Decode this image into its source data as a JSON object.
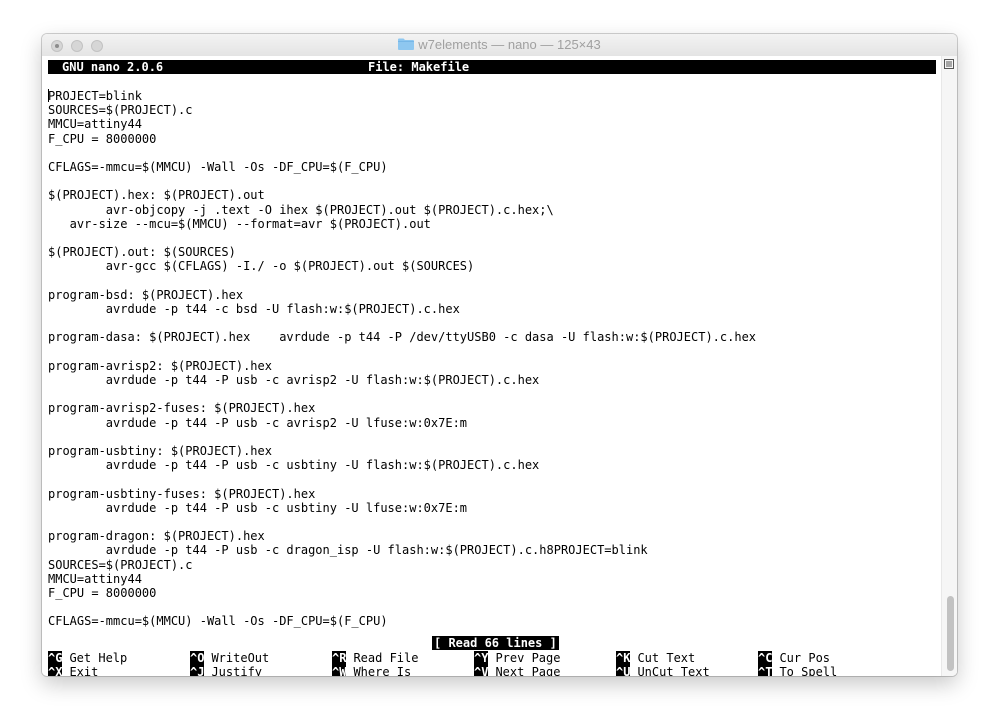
{
  "window": {
    "title": "w7elements — nano — 125×43"
  },
  "nano": {
    "version": "GNU nano 2.0.6",
    "file": "File: Makefile",
    "lines": [
      "PROJECT=blink",
      "SOURCES=$(PROJECT).c",
      "MMCU=attiny44",
      "F_CPU = 8000000",
      "",
      "CFLAGS=-mmcu=$(MMCU) -Wall -Os -DF_CPU=$(F_CPU)",
      "",
      "$(PROJECT).hex: $(PROJECT).out",
      "        avr-objcopy -j .text -O ihex $(PROJECT).out $(PROJECT).c.hex;\\",
      "   avr-size --mcu=$(MMCU) --format=avr $(PROJECT).out",
      "",
      "$(PROJECT).out: $(SOURCES)",
      "        avr-gcc $(CFLAGS) -I./ -o $(PROJECT).out $(SOURCES)",
      "",
      "program-bsd: $(PROJECT).hex",
      "        avrdude -p t44 -c bsd -U flash:w:$(PROJECT).c.hex",
      "",
      "program-dasa: $(PROJECT).hex    avrdude -p t44 -P /dev/ttyUSB0 -c dasa -U flash:w:$(PROJECT).c.hex",
      "",
      "program-avrisp2: $(PROJECT).hex",
      "        avrdude -p t44 -P usb -c avrisp2 -U flash:w:$(PROJECT).c.hex",
      "",
      "program-avrisp2-fuses: $(PROJECT).hex",
      "        avrdude -p t44 -P usb -c avrisp2 -U lfuse:w:0x7E:m",
      "",
      "program-usbtiny: $(PROJECT).hex",
      "        avrdude -p t44 -P usb -c usbtiny -U flash:w:$(PROJECT).c.hex",
      "",
      "program-usbtiny-fuses: $(PROJECT).hex",
      "        avrdude -p t44 -P usb -c usbtiny -U lfuse:w:0x7E:m",
      "",
      "program-dragon: $(PROJECT).hex",
      "        avrdude -p t44 -P usb -c dragon_isp -U flash:w:$(PROJECT).c.h8PROJECT=blink",
      "SOURCES=$(PROJECT).c",
      "MMCU=attiny44",
      "F_CPU = 8000000",
      "",
      "CFLAGS=-mmcu=$(MMCU) -Wall -Os -DF_CPU=$(F_CPU)"
    ],
    "status": "[ Read 66 lines ]",
    "shortcuts": [
      {
        "key": "^G",
        "label": "Get Help"
      },
      {
        "key": "^O",
        "label": "WriteOut"
      },
      {
        "key": "^R",
        "label": "Read File"
      },
      {
        "key": "^Y",
        "label": "Prev Page"
      },
      {
        "key": "^K",
        "label": "Cut Text"
      },
      {
        "key": "^C",
        "label": "Cur Pos"
      },
      {
        "key": "^X",
        "label": "Exit"
      },
      {
        "key": "^J",
        "label": "Justify"
      },
      {
        "key": "^W",
        "label": "Where Is"
      },
      {
        "key": "^V",
        "label": "Next Page"
      },
      {
        "key": "^U",
        "label": "UnCut Text"
      },
      {
        "key": "^T",
        "label": "To Spell"
      }
    ]
  },
  "icons": {
    "title_folder": "folder-icon",
    "scrollbar_menu": "list-icon"
  },
  "colors": {
    "folder": "#8ec7f0",
    "highlight_bg": "#000000",
    "highlight_fg": "#ffffff"
  }
}
